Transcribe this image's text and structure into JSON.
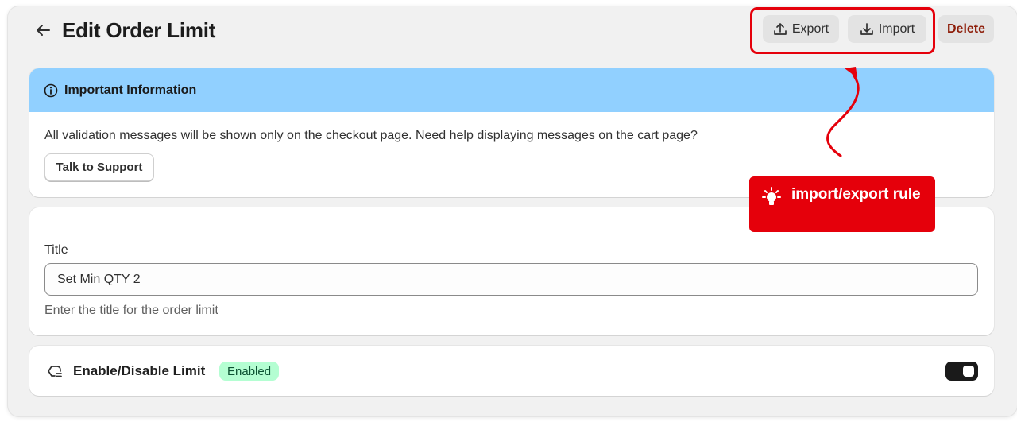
{
  "header": {
    "title": "Edit Order Limit",
    "export_label": "Export",
    "import_label": "Import",
    "delete_label": "Delete"
  },
  "info_banner": {
    "title": "Important Information",
    "message": "All validation messages will be shown only on the checkout page. Need help displaying messages on the cart page?",
    "support_button": "Talk to Support"
  },
  "title_field": {
    "label": "Title",
    "value": "Set Min QTY 2",
    "help": "Enter the title for the order limit"
  },
  "limit_toggle": {
    "label": "Enable/Disable Limit",
    "status": "Enabled",
    "enabled": true
  },
  "annotation": {
    "callout_text": "import/export rule",
    "color": "#e5000b"
  },
  "colors": {
    "banner": "#91d0ff",
    "badge_bg": "#b4fed2",
    "delete_text": "#8e1f0b",
    "toggle_on": "#1a1a1a"
  },
  "icons": [
    "back-arrow-icon",
    "export-icon",
    "import-icon",
    "info-icon",
    "limit-icon",
    "lightbulb-icon"
  ]
}
